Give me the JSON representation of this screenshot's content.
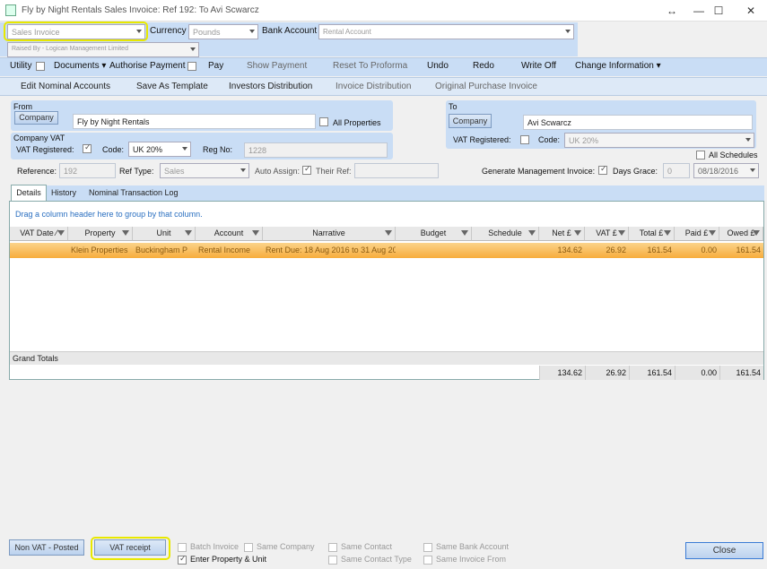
{
  "window": {
    "title": "Fly by Night Rentals Sales Invoice: Ref 192: To Avi Scwarcz",
    "controls": [
      "↔",
      "—",
      "☐",
      "✕"
    ]
  },
  "header": {
    "invoice_type": "Sales Invoice",
    "currency_label": "Currency",
    "currency_value": "Pounds",
    "bank_account_label": "Bank Account",
    "bank_account_value": "Rental Account",
    "raised_by": "Raised By - Logican Management Limited"
  },
  "toolbar": {
    "utility": "Utility",
    "documents": "Documents",
    "authorise_payment": "Authorise Payment",
    "pay": "Pay",
    "show_payment": "Show Payment",
    "reset_to_proforma": "Reset To Proforma",
    "undo": "Undo",
    "redo": "Redo",
    "write_off": "Write Off",
    "change_information": "Change Information"
  },
  "toolbar2": {
    "edit_nominal_accounts": "Edit Nominal Accounts",
    "save_as_template": "Save As Template",
    "investors_distribution": "Investors Distribution",
    "invoice_distribution": "Invoice Distribution",
    "original_purchase_invoice": "Original Purchase Invoice"
  },
  "from": {
    "label": "From",
    "company_button": "Company",
    "company_value": "Fly by Night Rentals",
    "all_properties": "All Properties"
  },
  "company_vat": {
    "label": "Company VAT",
    "vat_registered": "VAT Registered:",
    "code_label": "Code:",
    "code_value": "UK 20%",
    "reg_no_label": "Reg No:",
    "reg_no_value": "1228"
  },
  "to": {
    "label": "To",
    "company_button": "Company",
    "company_value": "Avi Scwarcz",
    "vat_registered": "VAT Registered:",
    "code_label": "Code:",
    "code_value": "UK 20%",
    "all_schedules": "All Schedules"
  },
  "reference_row": {
    "reference_label": "Reference:",
    "reference_value": "192",
    "ref_type_label": "Ref Type:",
    "ref_type_value": "Sales",
    "auto_assign": "Auto Assign:",
    "their_ref": "Their Ref:",
    "generate_mgmt_invoice": "Generate Management Invoice:",
    "days_grace": "Days Grace:",
    "days_grace_value": "0",
    "date_value": "08/18/2016"
  },
  "tabs": [
    "Details",
    "History",
    "Nominal Transaction Log"
  ],
  "grid": {
    "group_hint": "Drag a column header here to group by that column.",
    "columns": [
      "VAT Date",
      "Property",
      "Unit",
      "Account",
      "Narrative",
      "Budget",
      "Schedule",
      "Net £",
      "VAT £",
      "Total £",
      "Paid £",
      "Owed £"
    ],
    "rows": [
      {
        "vat_date": "",
        "property": "Klein Properties",
        "unit": "Buckingham P",
        "account": "Rental Income",
        "narrative": "Rent Due: 18 Aug 2016 to 31 Aug 201",
        "budget": "",
        "schedule": "",
        "net": "134.62",
        "vat": "26.92",
        "total": "161.54",
        "paid": "0.00",
        "owed": "161.54"
      }
    ],
    "grand_totals_label": "Grand Totals",
    "totals": {
      "net": "134.62",
      "vat": "26.92",
      "total": "161.54",
      "paid": "0.00",
      "owed": "161.54"
    }
  },
  "footer": {
    "non_vat_posted": "Non VAT - Posted",
    "vat_receipt": "VAT receipt",
    "batch_invoice": "Batch Invoice",
    "enter_property_unit": "Enter Property & Unit",
    "same_company": "Same Company",
    "same_contact": "Same Contact",
    "same_contact_type": "Same Contact Type",
    "same_bank_account": "Same Bank Account",
    "same_invoice_from": "Same Invoice From",
    "close": "Close"
  }
}
